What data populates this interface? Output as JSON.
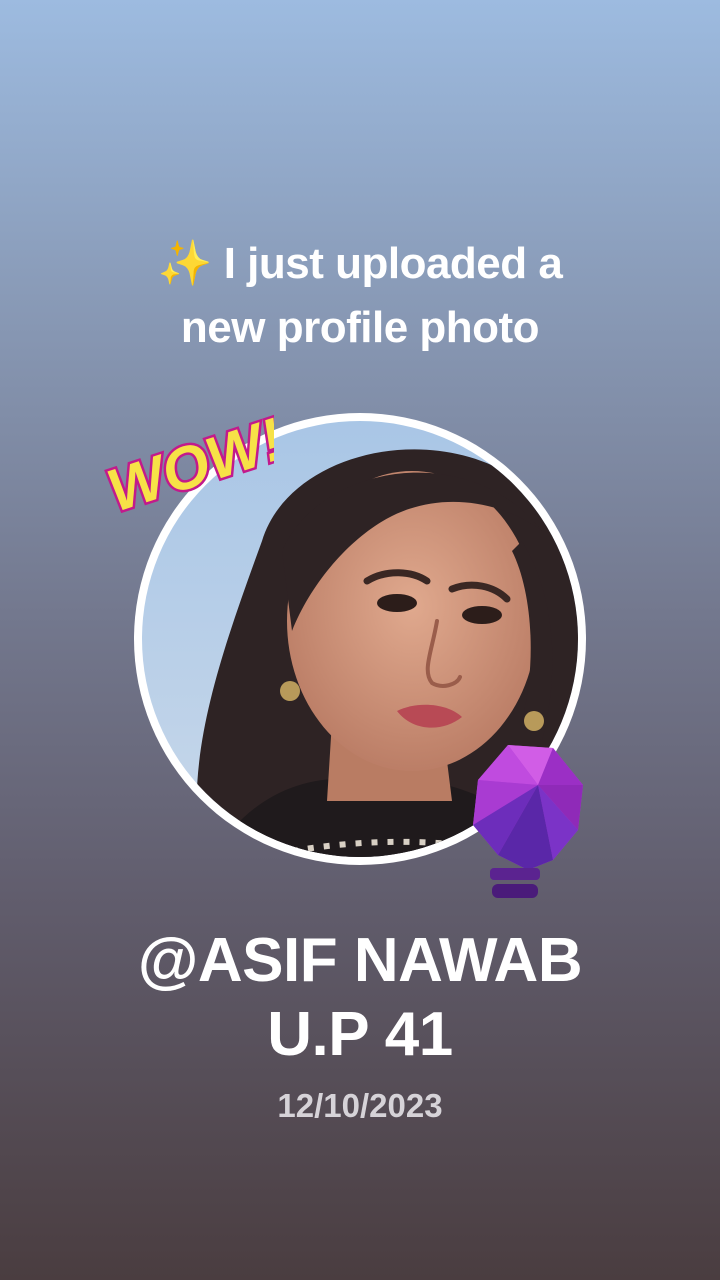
{
  "headline": {
    "sparkle": "✨",
    "line1": "I just uploaded a",
    "line2": "new profile photo"
  },
  "profile": {
    "username_line1": "@ASIF NAWAB",
    "username_line2": "U.P 41",
    "date": "12/10/2023"
  },
  "stickers": {
    "wow_text": "WOW!",
    "wow_icon": "wow-sticker-icon",
    "bulb_icon": "lightbulb-sticker-icon"
  },
  "colors": {
    "bg_top": "#9dbbe0",
    "bg_bottom": "#4a3d40",
    "text": "#ffffff",
    "date_text": "#d6d3d8",
    "wow_fill": "#f7e247",
    "wow_stroke": "#c21a8c",
    "bulb_primary": "#b13fd6"
  }
}
